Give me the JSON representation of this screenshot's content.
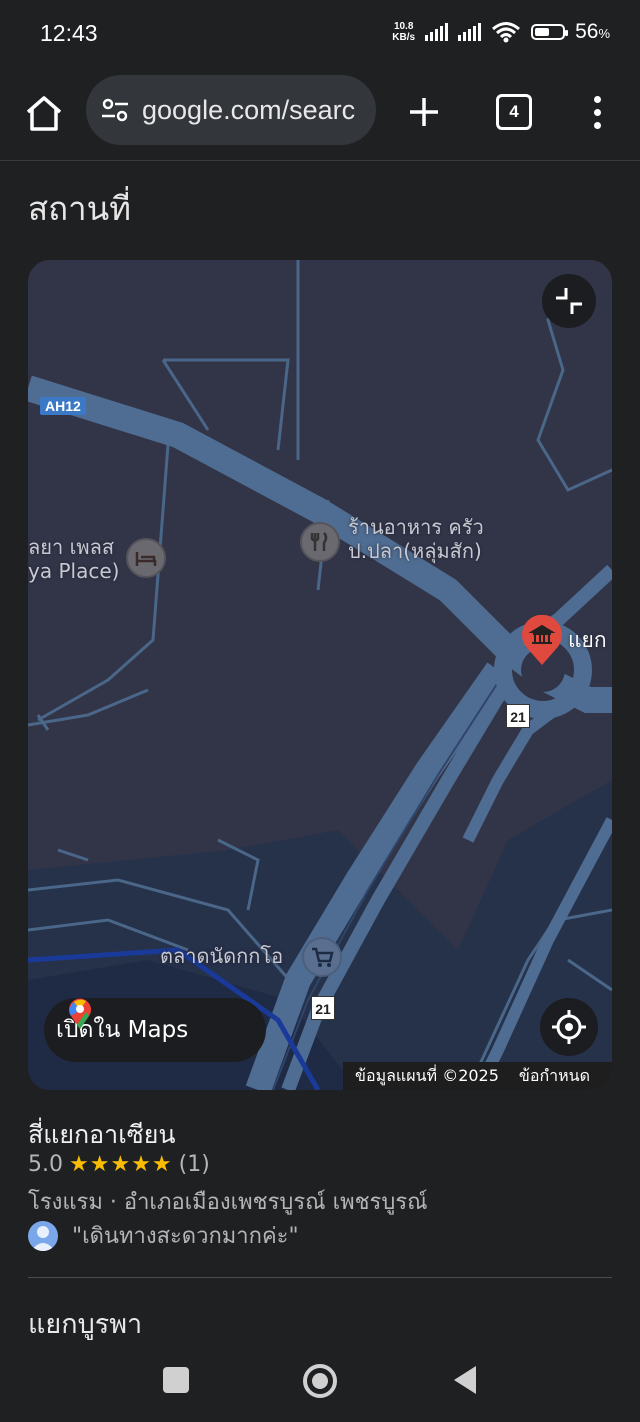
{
  "status_bar": {
    "time": "12:43",
    "net_speed_value": "10.8",
    "net_speed_unit": "KB/s",
    "battery_percent": "56",
    "battery_unit": "%"
  },
  "browser": {
    "url": "google.com/searc",
    "tab_count": "4"
  },
  "section_title": "สถานที่",
  "map": {
    "labels": {
      "route_ah12": "AH12",
      "restaurant_line1": "ร้านอาหาร ครัว",
      "restaurant_line2": "ป.ปลา(หลุ่มสัก)",
      "hotel_line1": "ลยา เพลส",
      "hotel_line2": "ya Place)",
      "intersection": "แยก",
      "market": "ตลาดนัดกกโอ",
      "highway_21_a": "21",
      "highway_21_b": "21"
    },
    "open_in_maps": "เปิดใน Maps",
    "attribution": "ข้อมูลแผนที่ ©2025",
    "terms": "ข้อกำหนด"
  },
  "place": {
    "name": "สี่แยกอาเซียน",
    "rating": "5.0",
    "stars": "★★★★★",
    "review_count": "(1)",
    "category": "โรงแรม · อำเภอเมืองเพชรบูรณ์ เพชรบูรณ์",
    "review_snippet": "\"เดินทางสะดวกมากค่ะ\""
  },
  "next_place": "แยกบูรพา",
  "colors": {
    "background": "#1f2022",
    "map_land": "#323548",
    "road": "#4f6d92",
    "star": "#fbbc04",
    "poi_red": "#e0493e"
  },
  "icons": [
    "home-icon",
    "tune-icon",
    "plus-icon",
    "more-vert-icon",
    "collapse-icon",
    "maps-pin-icon",
    "my-location-icon",
    "restaurant-icon",
    "hotel-icon",
    "museum-icon",
    "cart-icon",
    "nav-square-icon",
    "nav-circle-icon",
    "nav-back-icon"
  ]
}
